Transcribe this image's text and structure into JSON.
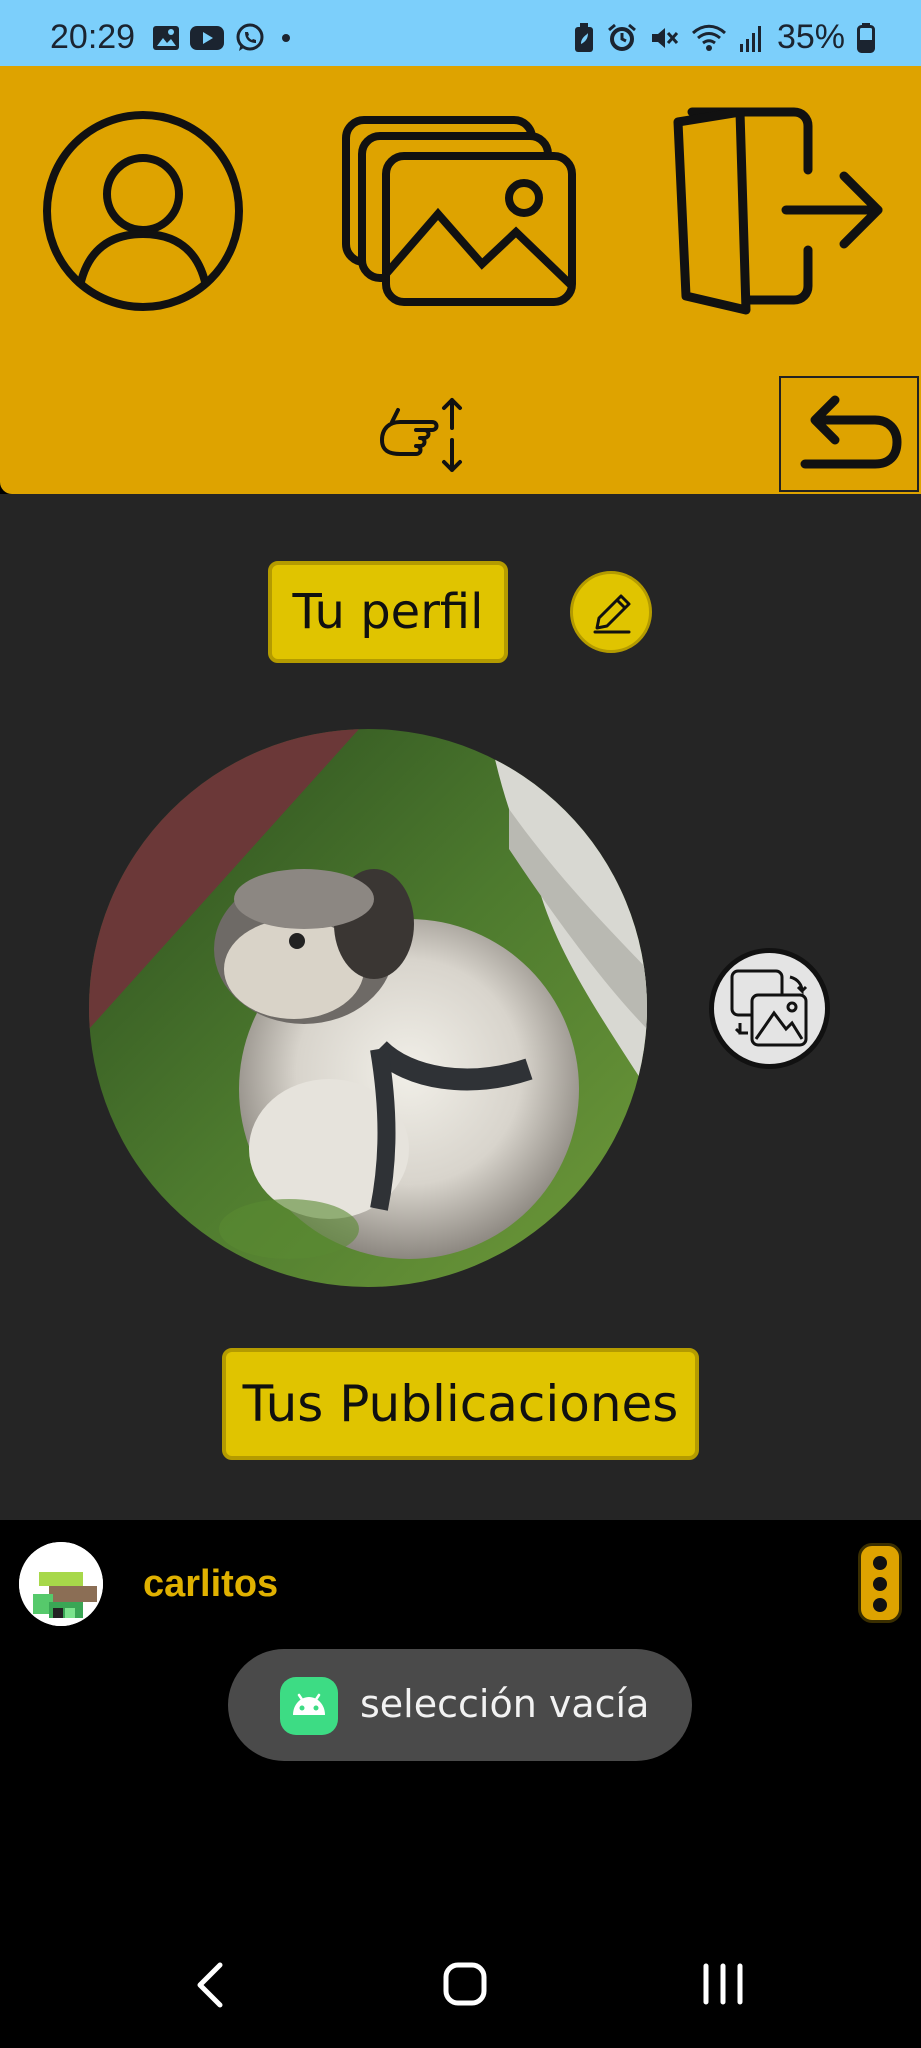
{
  "status_bar": {
    "time": "20:29",
    "battery": "35%",
    "left_icons": [
      "gallery-icon",
      "youtube-icon",
      "whatsapp-icon",
      "dot-icon"
    ],
    "right_icons": [
      "battery-saver-icon",
      "alarm-icon",
      "mute-icon",
      "wifi-icon",
      "signal-icon",
      "battery-icon"
    ]
  },
  "top_nav": {
    "icons": [
      "profile-icon",
      "gallery-stack-icon",
      "logout-icon",
      "swipe-hand-icon",
      "undo-icon"
    ]
  },
  "profile": {
    "title": "Tu perfil",
    "edit_icon": "pencil-icon",
    "change_photo_icon": "swap-image-icon",
    "publications_button": "Tus Publicaciones"
  },
  "user_bar": {
    "username": "carlitos",
    "menu_icon": "kebab-menu-icon"
  },
  "toast": {
    "message": "selección vacía",
    "icon": "android-icon"
  },
  "system_nav": {
    "icons": [
      "back-icon",
      "home-icon",
      "recents-icon"
    ]
  },
  "colors": {
    "status_bar": "#7ccffb",
    "top_bar": "#dea300",
    "content_bg": "#252525",
    "button_yellow": "#e0c400",
    "username": "#e0b100"
  }
}
